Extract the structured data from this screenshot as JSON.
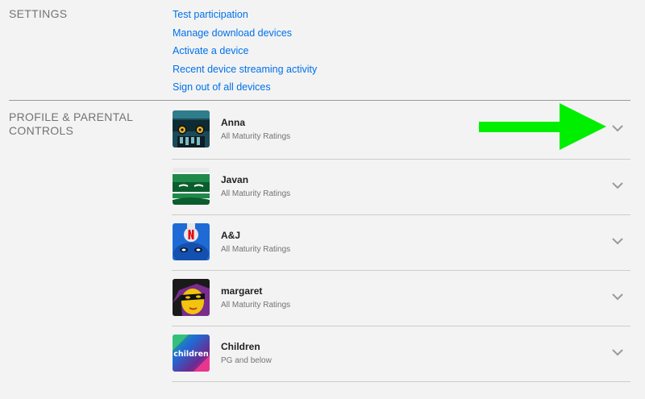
{
  "settings": {
    "heading": "SETTINGS",
    "links": [
      "Test participation",
      "Manage download devices",
      "Activate a device",
      "Recent device streaming activity",
      "Sign out of all devices"
    ]
  },
  "profiles_section": {
    "heading": "PROFILE & PARENTAL CONTROLS",
    "profiles": [
      {
        "name": "Anna",
        "rating": "All Maturity Ratings",
        "avatar_icon": "robot-face-icon"
      },
      {
        "name": "Javan",
        "rating": "All Maturity Ratings",
        "avatar_icon": "masked-face-icon"
      },
      {
        "name": "A&J",
        "rating": "All Maturity Ratings",
        "avatar_icon": "netflix-helmet-icon"
      },
      {
        "name": "margaret",
        "rating": "All Maturity Ratings",
        "avatar_icon": "masked-woman-icon"
      },
      {
        "name": "Children",
        "rating": "PG and below",
        "avatar_icon": "children-logo-icon",
        "avatar_text": "children"
      }
    ]
  },
  "annotation": {
    "icon": "green-arrow-icon",
    "color": "#00ee00"
  },
  "colors": {
    "link": "#0071eb",
    "background": "#f3f3f3",
    "label": "#737373"
  }
}
